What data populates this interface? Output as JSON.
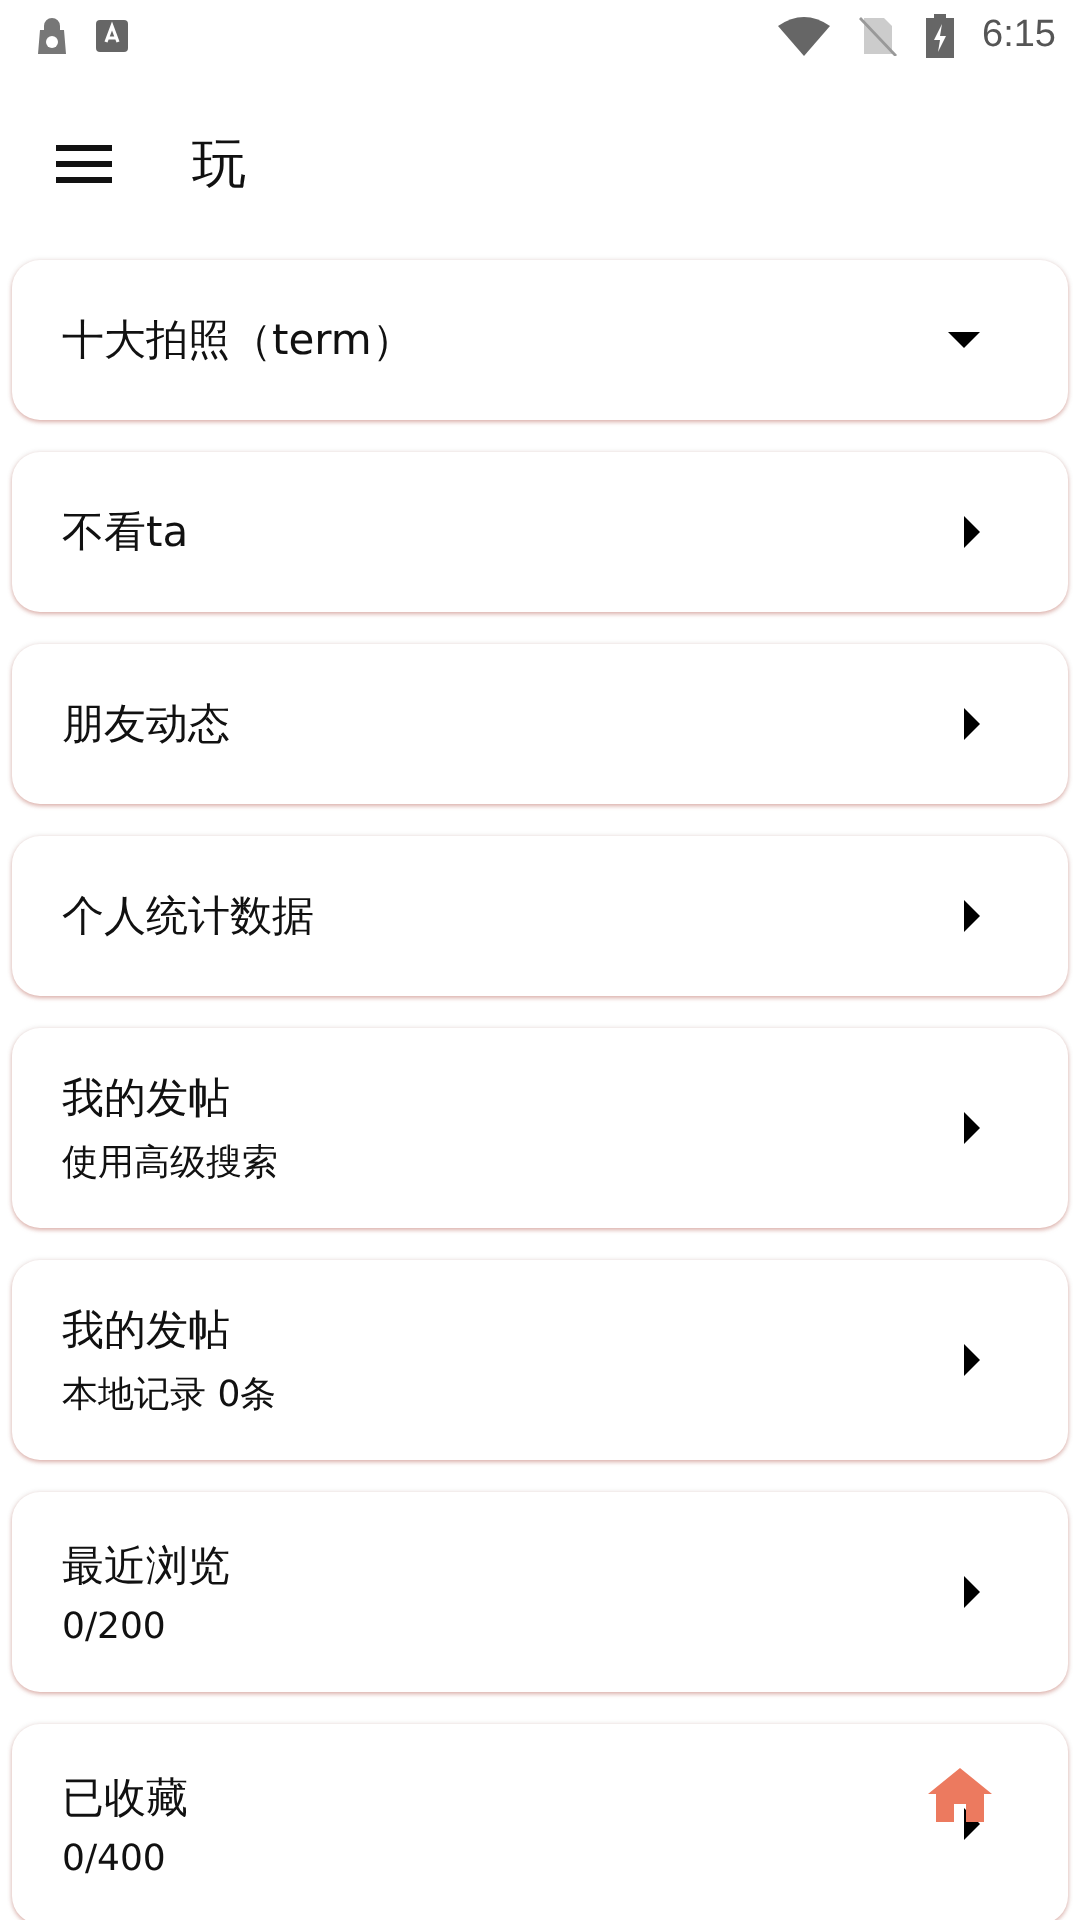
{
  "status_bar": {
    "time": "6:15"
  },
  "app_bar": {
    "title": "玩"
  },
  "items": [
    {
      "title": "十大拍照（term）",
      "expanded": true
    },
    {
      "title": "不看ta",
      "expanded": false
    },
    {
      "title": "朋友动态",
      "expanded": false
    },
    {
      "title": "个人统计数据",
      "expanded": false
    },
    {
      "title": "我的发帖",
      "subtitle": "使用高级搜索",
      "expanded": false
    },
    {
      "title": "我的发帖",
      "subtitle": "本地记录 0条",
      "expanded": false
    },
    {
      "title": "最近浏览",
      "subtitle": "0/200",
      "expanded": false
    },
    {
      "title": "已收藏",
      "subtitle": "0/400",
      "expanded": false
    }
  ]
}
